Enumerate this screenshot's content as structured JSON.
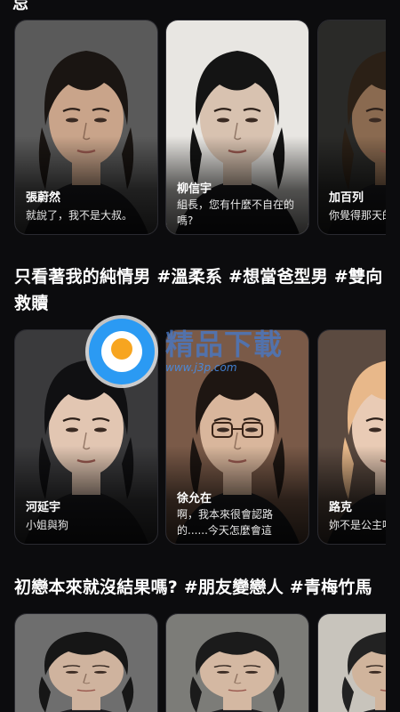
{
  "top_partial_title": "忌",
  "sections": [
    {
      "title": "",
      "cards": [
        {
          "name": "張蔚然",
          "desc": "就說了，我不是大叔。",
          "hair": "#1a1512",
          "skin": "#c9a48a",
          "bg": "#5a5a5a"
        },
        {
          "name": "柳信宇",
          "desc": "組長，您有什麼不自在的嗎?",
          "hair": "#141414",
          "skin": "#d8c2b0",
          "bg": "#e8e6e2"
        },
        {
          "name": "加百列",
          "desc": "你覺得那天的偶然嗎?",
          "hair": "#2b2016",
          "skin": "#8a6a50",
          "bg": "#2a2a28"
        }
      ]
    },
    {
      "title": "只看著我的純情男 #溫柔系 #想當爸型男 #雙向救贖",
      "cards": [
        {
          "name": "河延宇",
          "desc": "小姐與狗",
          "hair": "#101012",
          "skin": "#e2c6b2",
          "bg": "#3a3a3c"
        },
        {
          "name": "徐允在",
          "desc": "啊，我本來很會認路的......今天怎麼會這樣......",
          "hair": "#1e1612",
          "skin": "#d9b69c",
          "bg": "#7a5a48"
        },
        {
          "name": "路克",
          "desc": "妳不是公主嗎?是誰?",
          "hair": "#e8b88a",
          "skin": "#e9cbb5",
          "bg": "#5b4a40"
        }
      ]
    },
    {
      "title": "初戀本來就沒結果嗎? #朋友變戀人 #青梅竹馬",
      "cards": [
        {
          "name": "",
          "desc": "",
          "hair": "#161616",
          "skin": "#cfb39e",
          "bg": "#6e6e6e"
        },
        {
          "name": "",
          "desc": "",
          "hair": "#1b1b1b",
          "skin": "#d4b8a2",
          "bg": "#7c7c78"
        },
        {
          "name": "",
          "desc": "",
          "hair": "#222",
          "skin": "#d0b49c",
          "bg": "#c8c4bc"
        }
      ]
    }
  ],
  "watermark": {
    "title": "精品下載",
    "url": "www.j3p.com"
  }
}
